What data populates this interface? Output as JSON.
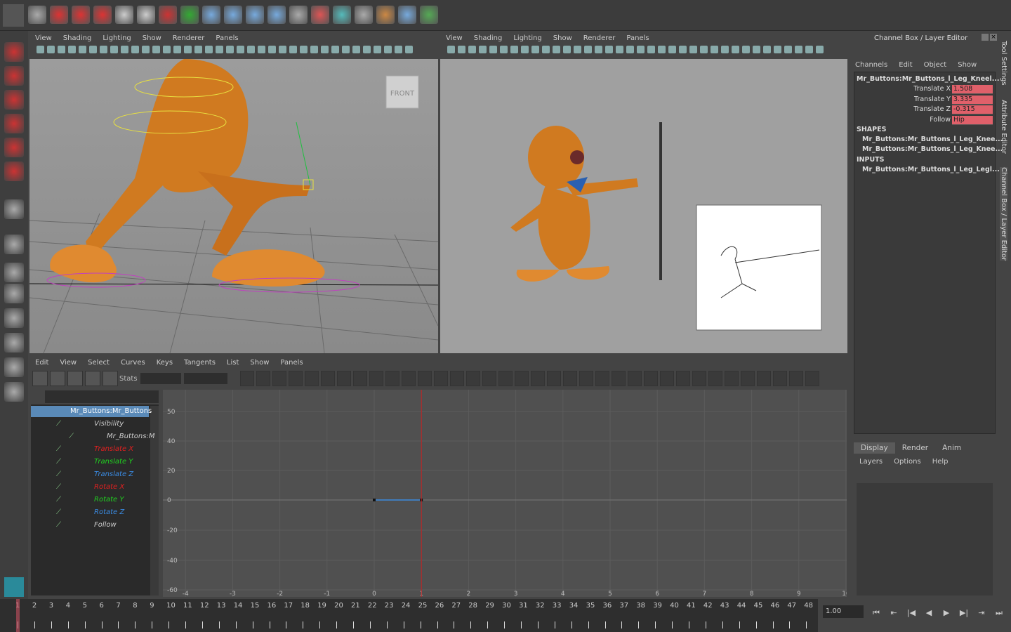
{
  "viewport_left": {
    "menu": [
      "View",
      "Shading",
      "Lighting",
      "Show",
      "Renderer",
      "Panels"
    ],
    "view_cube_label": "FRONT"
  },
  "viewport_right": {
    "menu": [
      "View",
      "Shading",
      "Lighting",
      "Show",
      "Renderer",
      "Panels"
    ]
  },
  "channel_box": {
    "title": "Channel Box / Layer Editor",
    "menu": [
      "Channels",
      "Edit",
      "Object",
      "Show"
    ],
    "node": "Mr_Buttons:Mr_Buttons_l_Leg_Kneel...",
    "attributes": [
      {
        "name": "Translate X",
        "value": "1.508"
      },
      {
        "name": "Translate Y",
        "value": "3.335"
      },
      {
        "name": "Translate Z",
        "value": "-0.315"
      },
      {
        "name": "Follow",
        "value": "Hip"
      }
    ],
    "shapes_label": "SHAPES",
    "shapes": [
      "Mr_Buttons:Mr_Buttons_l_Leg_Knee...",
      "Mr_Buttons:Mr_Buttons_l_Leg_Knee..."
    ],
    "inputs_label": "INPUTS",
    "inputs": [
      "Mr_Buttons:Mr_Buttons_l_Leg_Legl..."
    ],
    "accent": "#e0606a"
  },
  "side_tabs": [
    "Tool Settings",
    "Attribute Editor",
    "Channel Box / Layer Editor"
  ],
  "layer_editor": {
    "tabs": [
      "Display",
      "Render",
      "Anim"
    ],
    "menu": [
      "Layers",
      "Options",
      "Help"
    ]
  },
  "graph_editor": {
    "menu": [
      "Edit",
      "View",
      "Select",
      "Curves",
      "Keys",
      "Tangents",
      "List",
      "Show",
      "Panels"
    ],
    "stats_label": "Stats",
    "outliner": [
      {
        "label": "Mr_Buttons:Mr_Buttons",
        "color": "#ffffff",
        "indent": 0,
        "selected": true
      },
      {
        "label": "Visibility",
        "color": "#cccccc",
        "indent": 1
      },
      {
        "label": "Mr_Buttons:M",
        "color": "#cccccc",
        "indent": 2
      },
      {
        "label": "Translate X",
        "color": "#e02020",
        "indent": 1
      },
      {
        "label": "Translate Y",
        "color": "#20d020",
        "indent": 1
      },
      {
        "label": "Translate Z",
        "color": "#3a8ae0",
        "indent": 1
      },
      {
        "label": "Rotate X",
        "color": "#e02020",
        "indent": 1
      },
      {
        "label": "Rotate Y",
        "color": "#20d020",
        "indent": 1
      },
      {
        "label": "Rotate Z",
        "color": "#3a8ae0",
        "indent": 1
      },
      {
        "label": "Follow",
        "color": "#cccccc",
        "indent": 1
      }
    ],
    "y_ticks": [
      "50",
      "40",
      "20",
      "0",
      "-20",
      "-40",
      "-60"
    ],
    "x_ticks": [
      "-4",
      "-3",
      "-2",
      "-1",
      "0",
      "1",
      "2",
      "3",
      "4",
      "5",
      "6",
      "7",
      "8",
      "9",
      "10"
    ],
    "current_time": 1,
    "curve": {
      "x": [
        0,
        1
      ],
      "y": [
        0,
        0
      ],
      "color": "#3a8ae0"
    }
  },
  "timeline": {
    "start": 1,
    "end": 48,
    "current": 1,
    "current_time_field": "1.00"
  }
}
